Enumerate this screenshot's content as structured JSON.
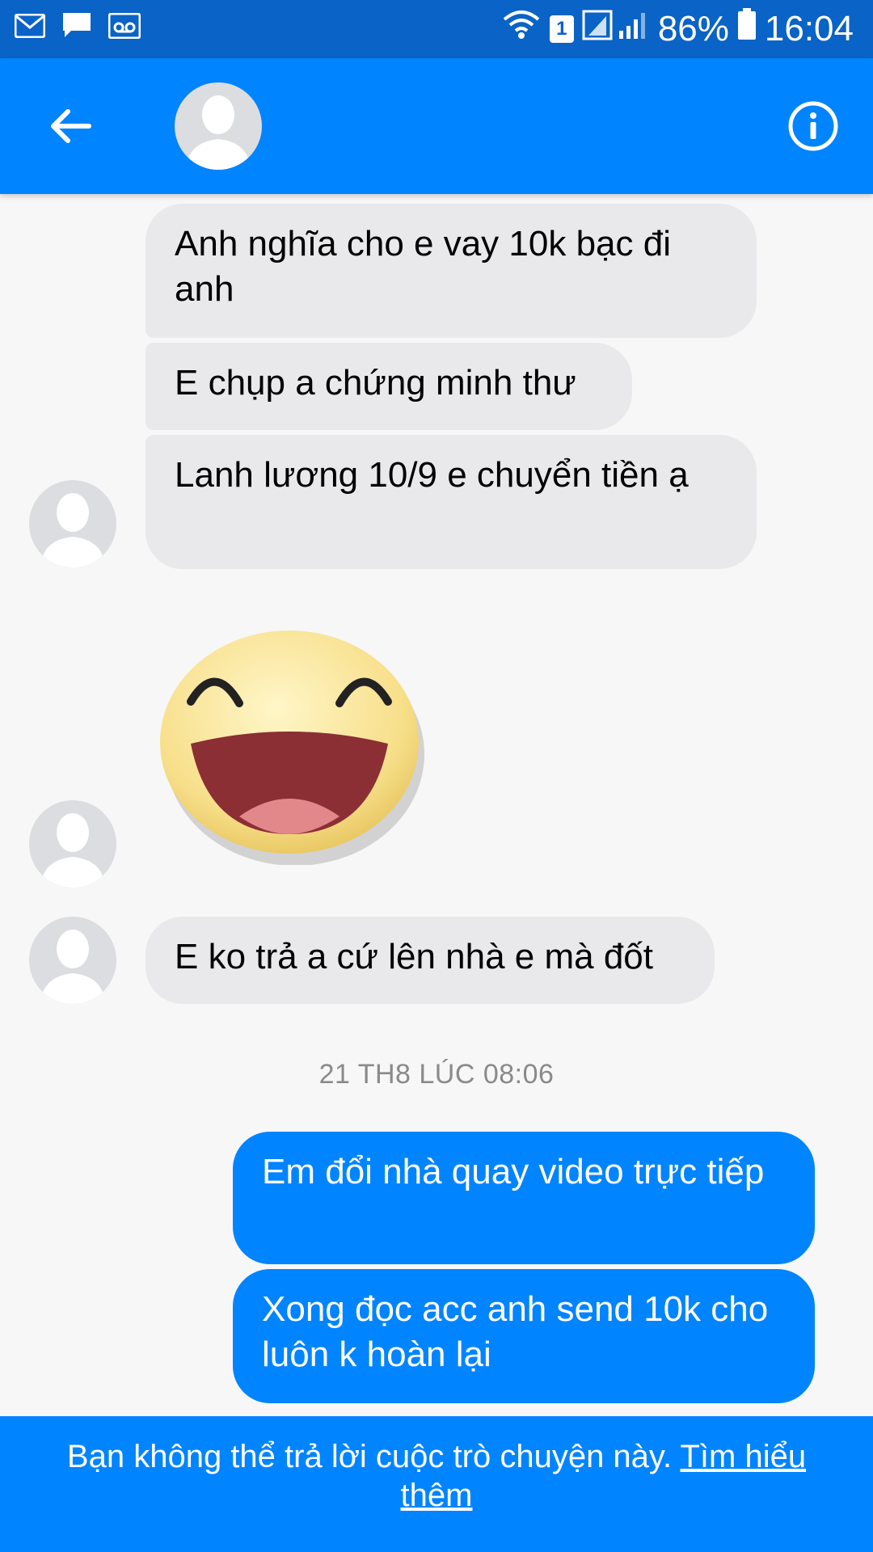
{
  "status_bar": {
    "battery": "86%",
    "time": "16:04",
    "sim_slot": "1",
    "icons": [
      "gmail-icon",
      "message-icon",
      "voicemail-icon",
      "wifi-icon",
      "signal-icon",
      "battery-icon"
    ]
  },
  "header": {
    "back_icon": "arrow-left-icon",
    "info_icon": "info-icon"
  },
  "messages": {
    "in_1": "Anh nghĩa cho e vay 10k bạc đi anh",
    "in_2": "E chụp a chứng minh thư",
    "in_3": "Lanh lương 10/9 e chuyển tiền ạ",
    "in_4": "E ko trả a cứ lên nhà e mà đốt",
    "timestamp": "21 TH8 LÚC 08:06",
    "out_1": "Em đổi nhà quay video trực tiếp",
    "out_2": "Xong đọc acc anh send 10k cho luôn k hoàn lại"
  },
  "footer": {
    "text": "Bạn không thể trả lời cuộc trò chuyện này.",
    "link": "Tìm hiểu thêm"
  },
  "colors": {
    "status_bar": "#0a63c6",
    "accent": "#0084ff",
    "incoming_bubble": "#e9e9eb",
    "background": "#f7f7f7"
  }
}
